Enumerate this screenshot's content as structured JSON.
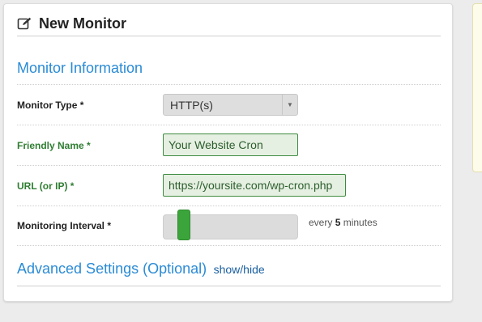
{
  "header": {
    "title": "New Monitor",
    "icon": "edit-icon"
  },
  "section": {
    "title": "Monitor Information"
  },
  "fields": {
    "monitor_type": {
      "label": "Monitor Type *",
      "value": "HTTP(s)"
    },
    "friendly_name": {
      "label": "Friendly Name *",
      "value": "Your Website Cron"
    },
    "url": {
      "label": "URL (or IP) *",
      "value": "https://yoursite.com/wp-cron.php"
    },
    "interval": {
      "label": "Monitoring Interval *",
      "prefix": "every",
      "value": "5",
      "suffix": "minutes",
      "slider_position_fraction": 0.12
    }
  },
  "advanced": {
    "title": "Advanced Settings (Optional)",
    "toggle_label": "show/hide"
  },
  "colors": {
    "accent_blue": "#2a8bd6",
    "valid_green": "#3d8a3f",
    "slider_green": "#3ba53b"
  }
}
